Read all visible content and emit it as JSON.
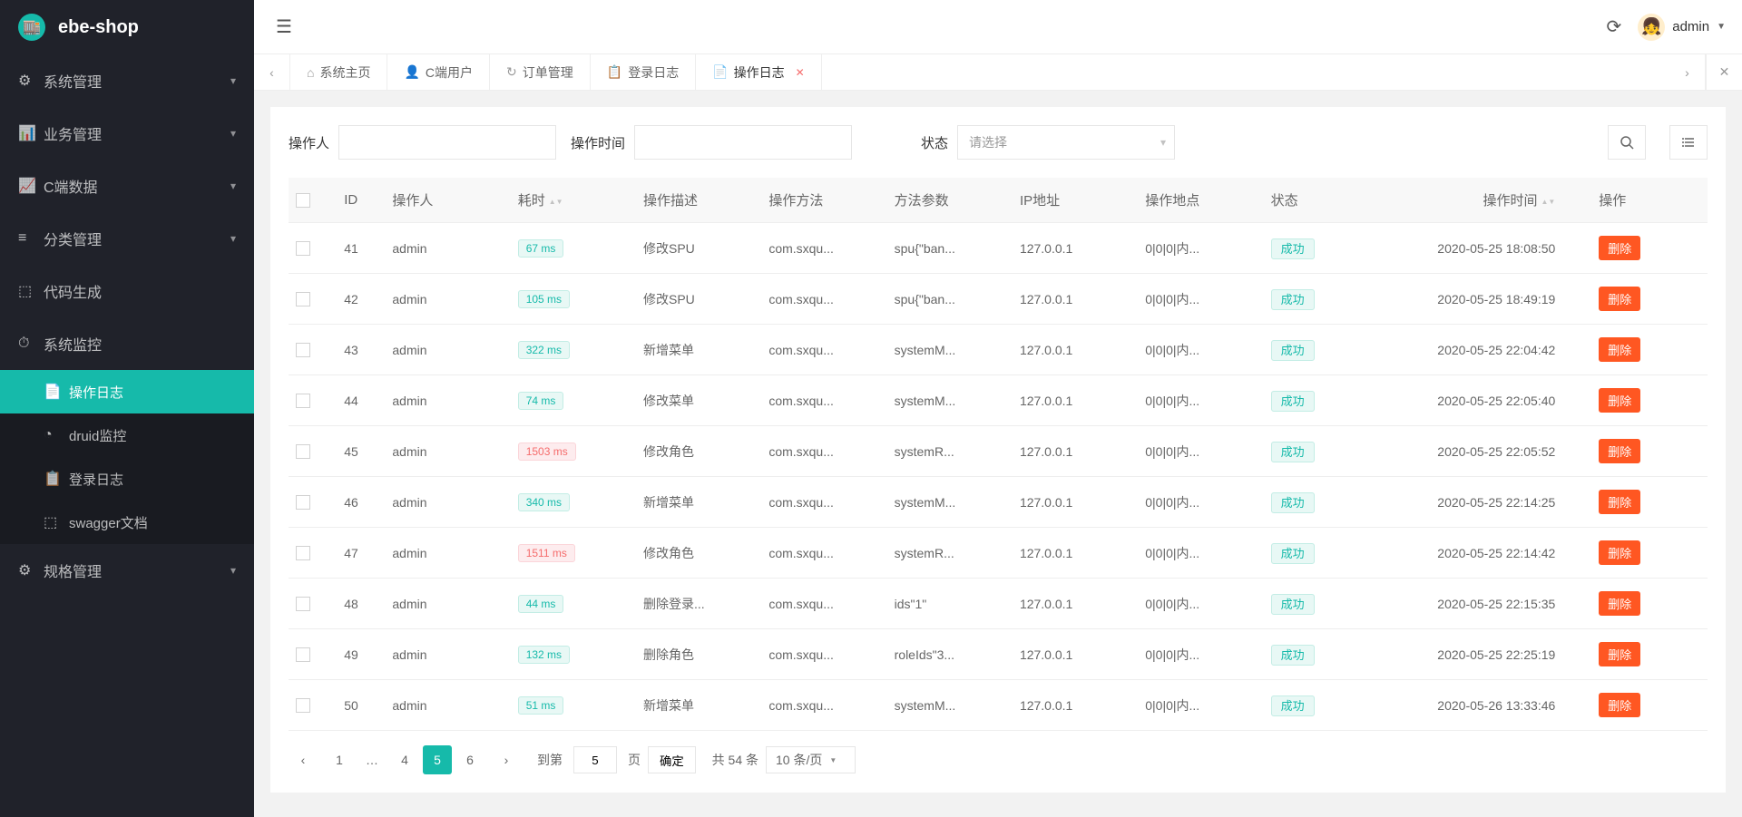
{
  "app": {
    "name": "ebe-shop"
  },
  "header": {
    "user_name": "admin"
  },
  "sidebar": {
    "items": [
      {
        "icon": "⚙",
        "label": "系统管理",
        "expandable": true
      },
      {
        "icon": "📊",
        "label": "业务管理",
        "expandable": true
      },
      {
        "icon": "📈",
        "label": "C端数据",
        "expandable": true
      },
      {
        "icon": "≡",
        "label": "分类管理",
        "expandable": true
      },
      {
        "icon": "⬚",
        "label": "代码生成",
        "expandable": false
      },
      {
        "icon": "⏱",
        "label": "系统监控",
        "expandable": false,
        "open": true,
        "children": [
          {
            "icon": "📄",
            "label": "操作日志",
            "active": true
          },
          {
            "icon": "◔",
            "label": "druid监控"
          },
          {
            "icon": "📋",
            "label": "登录日志"
          },
          {
            "icon": "⬚",
            "label": "swagger文档"
          }
        ]
      },
      {
        "icon": "⚙",
        "label": "规格管理",
        "expandable": true
      }
    ]
  },
  "tabs": {
    "list": [
      {
        "icon": "⌂",
        "label": "系统主页"
      },
      {
        "icon": "👤",
        "label": "C端用户"
      },
      {
        "icon": "↻",
        "label": "订单管理"
      },
      {
        "icon": "📋",
        "label": "登录日志"
      },
      {
        "icon": "📄",
        "label": "操作日志",
        "active": true,
        "closable": true
      }
    ]
  },
  "filters": {
    "operator_label": "操作人",
    "time_label": "操作时间",
    "status_label": "状态",
    "status_placeholder": "请选择"
  },
  "table": {
    "headers": {
      "id": "ID",
      "operator": "操作人",
      "cost": "耗时",
      "desc": "操作描述",
      "method": "操作方法",
      "params": "方法参数",
      "ip": "IP地址",
      "location": "操作地点",
      "status": "状态",
      "time": "操作时间",
      "action": "操作"
    },
    "status_success": "成功",
    "delete_label": "删除",
    "rows": [
      {
        "id": "41",
        "operator": "admin",
        "cost": "67 ms",
        "cost_level": "green",
        "desc": "修改SPU",
        "method": "com.sxqu...",
        "params": "spu{\"ban...",
        "ip": "127.0.0.1",
        "location": "0|0|0|内...",
        "time": "2020-05-25 18:08:50"
      },
      {
        "id": "42",
        "operator": "admin",
        "cost": "105 ms",
        "cost_level": "green",
        "desc": "修改SPU",
        "method": "com.sxqu...",
        "params": "spu{\"ban...",
        "ip": "127.0.0.1",
        "location": "0|0|0|内...",
        "time": "2020-05-25 18:49:19"
      },
      {
        "id": "43",
        "operator": "admin",
        "cost": "322 ms",
        "cost_level": "green",
        "desc": "新增菜单",
        "method": "com.sxqu...",
        "params": "systemM...",
        "ip": "127.0.0.1",
        "location": "0|0|0|内...",
        "time": "2020-05-25 22:04:42"
      },
      {
        "id": "44",
        "operator": "admin",
        "cost": "74 ms",
        "cost_level": "green",
        "desc": "修改菜单",
        "method": "com.sxqu...",
        "params": "systemM...",
        "ip": "127.0.0.1",
        "location": "0|0|0|内...",
        "time": "2020-05-25 22:05:40"
      },
      {
        "id": "45",
        "operator": "admin",
        "cost": "1503 ms",
        "cost_level": "red",
        "desc": "修改角色",
        "method": "com.sxqu...",
        "params": "systemR...",
        "ip": "127.0.0.1",
        "location": "0|0|0|内...",
        "time": "2020-05-25 22:05:52"
      },
      {
        "id": "46",
        "operator": "admin",
        "cost": "340 ms",
        "cost_level": "green",
        "desc": "新增菜单",
        "method": "com.sxqu...",
        "params": "systemM...",
        "ip": "127.0.0.1",
        "location": "0|0|0|内...",
        "time": "2020-05-25 22:14:25"
      },
      {
        "id": "47",
        "operator": "admin",
        "cost": "1511 ms",
        "cost_level": "red",
        "desc": "修改角色",
        "method": "com.sxqu...",
        "params": "systemR...",
        "ip": "127.0.0.1",
        "location": "0|0|0|内...",
        "time": "2020-05-25 22:14:42"
      },
      {
        "id": "48",
        "operator": "admin",
        "cost": "44 ms",
        "cost_level": "green",
        "desc": "删除登录...",
        "method": "com.sxqu...",
        "params": "ids\"1\"",
        "ip": "127.0.0.1",
        "location": "0|0|0|内...",
        "time": "2020-05-25 22:15:35"
      },
      {
        "id": "49",
        "operator": "admin",
        "cost": "132 ms",
        "cost_level": "green",
        "desc": "删除角色",
        "method": "com.sxqu...",
        "params": "roleIds\"3...",
        "ip": "127.0.0.1",
        "location": "0|0|0|内...",
        "time": "2020-05-25 22:25:19"
      },
      {
        "id": "50",
        "operator": "admin",
        "cost": "51 ms",
        "cost_level": "green",
        "desc": "新增菜单",
        "method": "com.sxqu...",
        "params": "systemM...",
        "ip": "127.0.0.1",
        "location": "0|0|0|内...",
        "time": "2020-05-26 13:33:46"
      }
    ]
  },
  "pagination": {
    "pages": [
      "1",
      "…",
      "4",
      "5",
      "6"
    ],
    "current": "5",
    "goto_label": "到第",
    "goto_value": "5",
    "page_label": "页",
    "confirm": "确定",
    "total": "共 54 条",
    "size": "10 条/页"
  }
}
